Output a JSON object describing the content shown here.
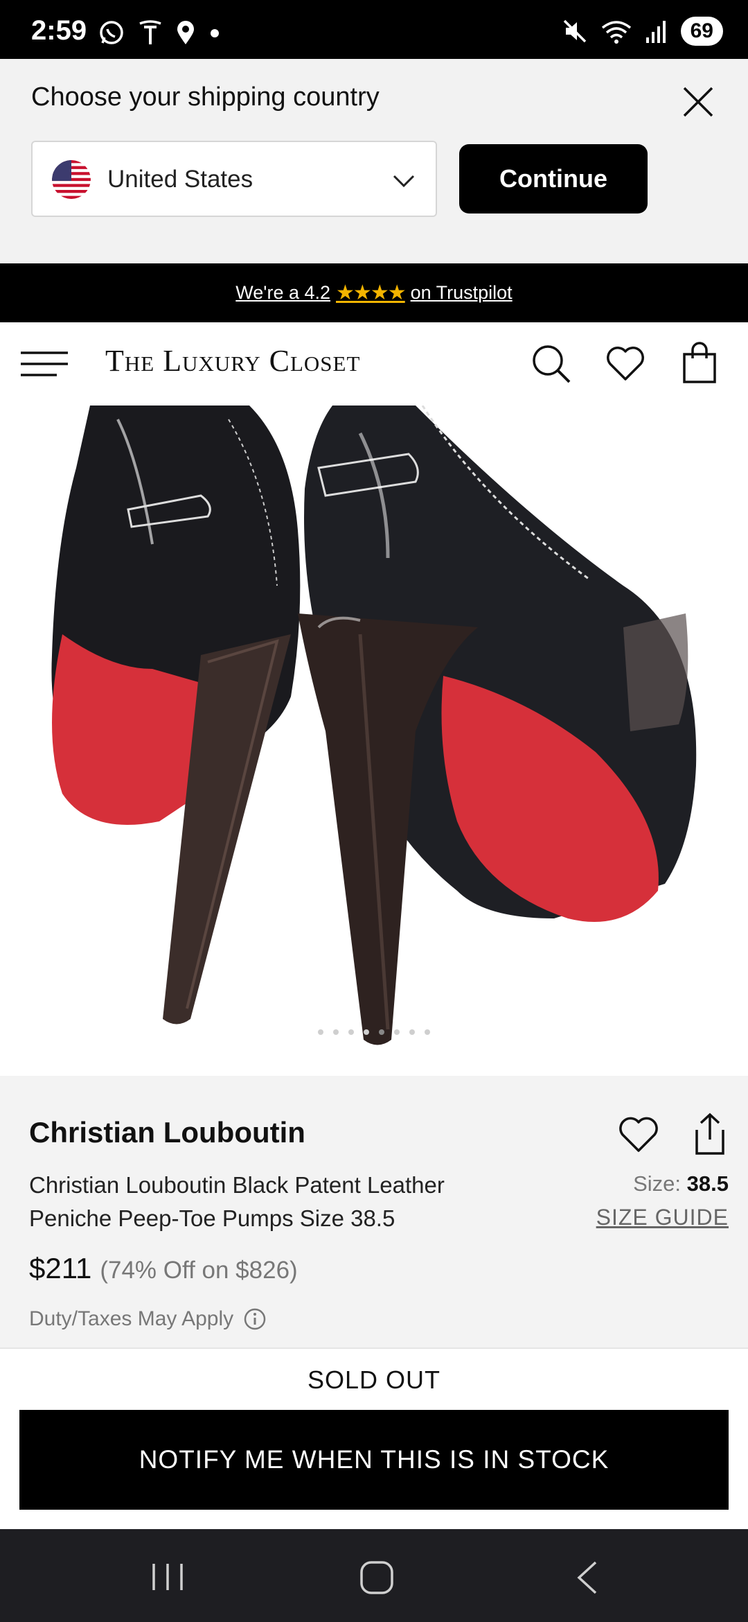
{
  "status_bar": {
    "time": "2:59",
    "battery": "69",
    "left_icons": [
      "whatsapp-icon",
      "tesla-icon",
      "location-icon",
      "dot-icon"
    ],
    "right_icons": [
      "mute-icon",
      "wifi-icon",
      "signal-icon"
    ]
  },
  "shipping": {
    "title": "Choose your shipping country",
    "selected_country": "United States",
    "continue_label": "Continue"
  },
  "trustpilot": {
    "prefix": "We're a 4.2",
    "stars": "★★★★",
    "suffix": "on Trustpilot"
  },
  "header": {
    "logo": "The Luxury Closet"
  },
  "gallery": {
    "image_count": 8,
    "active_index": 4
  },
  "product": {
    "brand": "Christian Louboutin",
    "name": "Christian Louboutin Black Patent Leather Peniche Peep-Toe Pumps Size 38.5",
    "size_label": "Size:",
    "size_value": "38.5",
    "size_guide": "SIZE GUIDE",
    "price": "$211",
    "discount": "(74% Off on $826)",
    "duty_note": "Duty/Taxes May Apply"
  },
  "purchase": {
    "status": "SOLD OUT",
    "notify_label": "NOTIFY ME WHEN THIS IS IN STOCK"
  },
  "colors": {
    "accent": "#000000",
    "banner_bg": "#f2f2f2",
    "star": "#f4b400",
    "sole_red": "#d6303a"
  }
}
